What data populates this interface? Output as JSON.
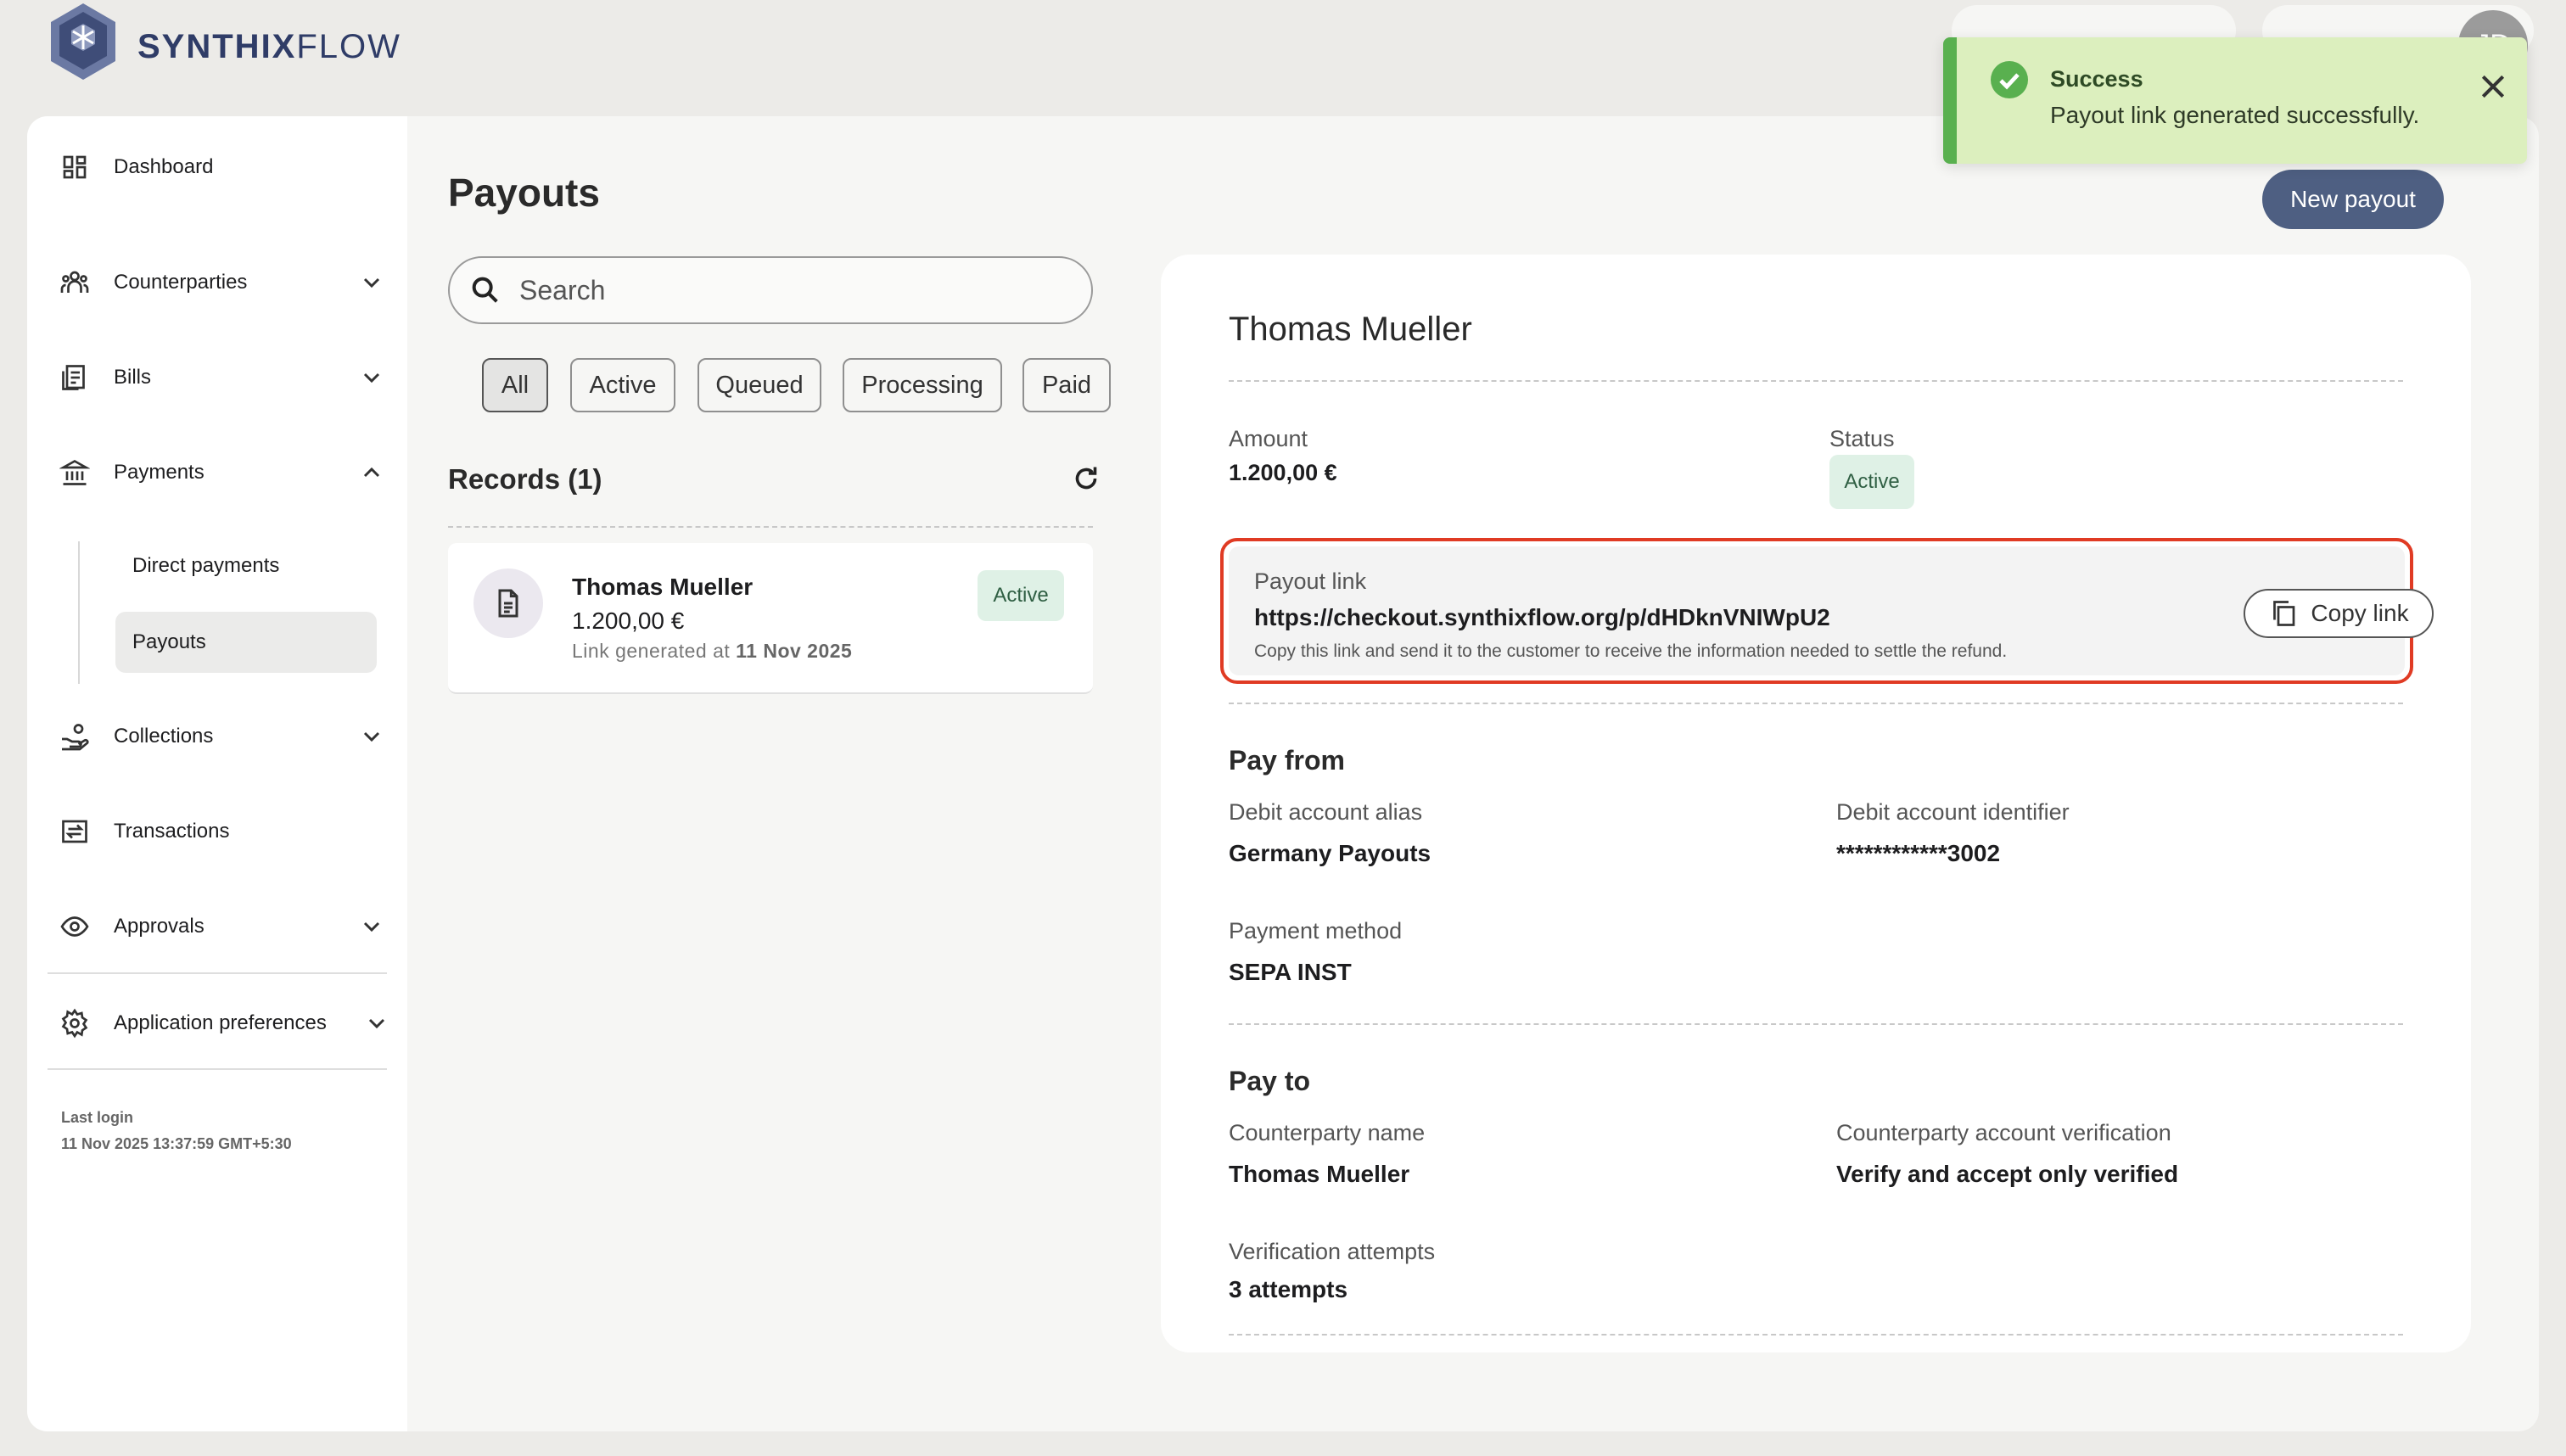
{
  "brand": {
    "strong": "SYNTHIX",
    "light": "FLOW"
  },
  "header": {
    "avatar_initials": "JD"
  },
  "sidebar": {
    "items": [
      {
        "label": "Dashboard",
        "icon": "dashboard-icon"
      },
      {
        "label": "Counterparties",
        "icon": "people-icon"
      },
      {
        "label": "Bills",
        "icon": "document-icon"
      },
      {
        "label": "Payments",
        "icon": "bank-icon"
      },
      {
        "label": "Collections",
        "icon": "hand-coins-icon"
      },
      {
        "label": "Transactions",
        "icon": "transfer-icon"
      },
      {
        "label": "Approvals",
        "icon": "eye-icon"
      },
      {
        "label": "Application preferences",
        "icon": "gear-icon"
      }
    ],
    "payments_subitems": [
      "Direct payments",
      "Payouts"
    ],
    "last_login_label": "Last login",
    "last_login_value": "11 Nov 2025 13:37:59 GMT+5:30"
  },
  "page": {
    "title": "Payouts",
    "new_button": "New payout",
    "search_placeholder": "Search",
    "filters": [
      "All",
      "Active",
      "Queued",
      "Processing",
      "Paid"
    ],
    "records_title": "Records (1)"
  },
  "records": [
    {
      "name": "Thomas Mueller",
      "amount": "1.200,00 €",
      "date_prefix": "Link generated at",
      "date": "11 Nov 2025",
      "status": "Active"
    }
  ],
  "detail": {
    "name": "Thomas Mueller",
    "amount_label": "Amount",
    "amount_value": "1.200,00 €",
    "status_label": "Status",
    "status_value": "Active",
    "payout_link_label": "Payout link",
    "payout_link_url": "https://checkout.synthixflow.org/p/dHDknVNIWpU2",
    "payout_link_hint": "Copy this link and send it to the customer to receive the information needed to settle the refund.",
    "copy_button": "Copy link",
    "pay_from": {
      "title": "Pay from",
      "debit_alias_label": "Debit account alias",
      "debit_alias_value": "Germany Payouts",
      "debit_id_label": "Debit account identifier",
      "debit_id_value": "************3002",
      "method_label": "Payment method",
      "method_value": "SEPA INST"
    },
    "pay_to": {
      "title": "Pay to",
      "cp_name_label": "Counterparty name",
      "cp_name_value": "Thomas Mueller",
      "cp_verif_label": "Counterparty account verification",
      "cp_verif_value": "Verify and accept only verified",
      "attempts_label": "Verification attempts",
      "attempts_value": "3 attempts"
    }
  },
  "toast": {
    "title": "Success",
    "message": "Payout link generated successfully."
  },
  "colors": {
    "brand_navy": "#2f3c67",
    "primary_button": "#4e5f82",
    "success_bg": "#dcefbe",
    "success_accent": "#59b04f",
    "highlight_red": "#e03b24",
    "active_badge_bg": "#dff1e6"
  }
}
